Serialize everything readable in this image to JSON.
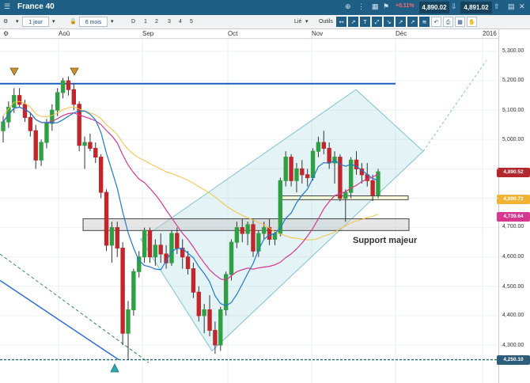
{
  "window": {
    "title": "France 40",
    "change": "+0.11%",
    "sell_price": "4,890.02",
    "buy_price": "4,891.02",
    "colors": {
      "header": "#1f5f86",
      "change": "#ff6a6a"
    }
  },
  "toolbar": {
    "interval": "1 jour",
    "period": "6 mois",
    "range_buttons": [
      "D",
      "1",
      "2",
      "3",
      "4",
      "5"
    ],
    "linked_label": "Lié",
    "tools_label": "Outils"
  },
  "chart_data": {
    "type": "candlestick",
    "months": [
      "Aoû",
      "Sep",
      "Oct",
      "Nov",
      "Déc",
      "2016"
    ],
    "y_ticks": [
      "5,300.00",
      "5,200.00",
      "5,100.00",
      "5,000.00",
      "4,700.00",
      "4,600.00",
      "4,500.00",
      "4,400.00",
      "4,300.00"
    ],
    "ylim": [
      4230,
      5330
    ],
    "last_price": "4,890.52",
    "ma_short_last": "4,800.72",
    "ma_long_last": "4,739.64",
    "support_line": "4,250.10",
    "annotation": "Support majeur",
    "colors": {
      "up": "#2ea043",
      "down": "#c0262b",
      "ma_fast": "#1f78d1",
      "ma_slow": "#d6378f",
      "ma_long": "#f5c242",
      "channel": "#7fc3d4"
    },
    "candles": [
      [
        5030,
        5080,
        4990,
        5060
      ],
      [
        5060,
        5130,
        5040,
        5110
      ],
      [
        5110,
        5175,
        5090,
        5150
      ],
      [
        5150,
        5175,
        5110,
        5120
      ],
      [
        5120,
        5135,
        5060,
        5075
      ],
      [
        5075,
        5090,
        5010,
        5030
      ],
      [
        5030,
        5050,
        4900,
        4930
      ],
      [
        4930,
        5000,
        4910,
        4990
      ],
      [
        4990,
        5070,
        4970,
        5055
      ],
      [
        5055,
        5120,
        5030,
        5100
      ],
      [
        5100,
        5175,
        5080,
        5160
      ],
      [
        5160,
        5210,
        5140,
        5200
      ],
      [
        5200,
        5215,
        5150,
        5170
      ],
      [
        5170,
        5190,
        5100,
        5120
      ],
      [
        5120,
        5130,
        4960,
        4980
      ],
      [
        4980,
        5010,
        4900,
        4990
      ],
      [
        4990,
        5020,
        4960,
        4970
      ],
      [
        4970,
        4990,
        4920,
        4940
      ],
      [
        4940,
        4950,
        4800,
        4820
      ],
      [
        4820,
        4830,
        4620,
        4640
      ],
      [
        4640,
        4720,
        4580,
        4700
      ],
      [
        4700,
        4720,
        4600,
        4630
      ],
      [
        4630,
        4650,
        4300,
        4340
      ],
      [
        4340,
        4450,
        4250,
        4420
      ],
      [
        4420,
        4560,
        4400,
        4550
      ],
      [
        4550,
        4620,
        4530,
        4600
      ],
      [
        4600,
        4700,
        4580,
        4690
      ],
      [
        4690,
        4700,
        4580,
        4600
      ],
      [
        4600,
        4660,
        4570,
        4640
      ],
      [
        4640,
        4680,
        4580,
        4610
      ],
      [
        4610,
        4640,
        4560,
        4580
      ],
      [
        4580,
        4690,
        4570,
        4680
      ],
      [
        4680,
        4700,
        4610,
        4630
      ],
      [
        4630,
        4660,
        4560,
        4600
      ],
      [
        4600,
        4620,
        4540,
        4560
      ],
      [
        4560,
        4580,
        4460,
        4480
      ],
      [
        4480,
        4500,
        4380,
        4400
      ],
      [
        4400,
        4440,
        4340,
        4420
      ],
      [
        4420,
        4470,
        4330,
        4350
      ],
      [
        4350,
        4380,
        4270,
        4300
      ],
      [
        4300,
        4430,
        4280,
        4420
      ],
      [
        4420,
        4550,
        4400,
        4540
      ],
      [
        4540,
        4660,
        4520,
        4650
      ],
      [
        4650,
        4720,
        4630,
        4700
      ],
      [
        4700,
        4730,
        4650,
        4680
      ],
      [
        4680,
        4720,
        4640,
        4710
      ],
      [
        4710,
        4730,
        4600,
        4620
      ],
      [
        4620,
        4690,
        4600,
        4680
      ],
      [
        4680,
        4720,
        4660,
        4700
      ],
      [
        4700,
        4730,
        4640,
        4660
      ],
      [
        4660,
        4690,
        4640,
        4680
      ],
      [
        4680,
        4870,
        4670,
        4860
      ],
      [
        4860,
        4960,
        4840,
        4940
      ],
      [
        4940,
        4950,
        4840,
        4860
      ],
      [
        4860,
        4920,
        4820,
        4900
      ],
      [
        4900,
        4930,
        4850,
        4880
      ],
      [
        4880,
        4900,
        4840,
        4870
      ],
      [
        4870,
        4970,
        4860,
        4960
      ],
      [
        4960,
        5010,
        4940,
        4990
      ],
      [
        4990,
        5030,
        4950,
        4970
      ],
      [
        4970,
        4990,
        4900,
        4920
      ],
      [
        4920,
        4960,
        4850,
        4940
      ],
      [
        4940,
        4950,
        4790,
        4800
      ],
      [
        4800,
        4830,
        4720,
        4820
      ],
      [
        4820,
        4940,
        4800,
        4930
      ],
      [
        4930,
        4960,
        4880,
        4900
      ],
      [
        4900,
        4920,
        4850,
        4880
      ],
      [
        4880,
        4920,
        4840,
        4860
      ],
      [
        4860,
        4880,
        4790,
        4810
      ],
      [
        4810,
        4900,
        4800,
        4890
      ]
    ]
  }
}
